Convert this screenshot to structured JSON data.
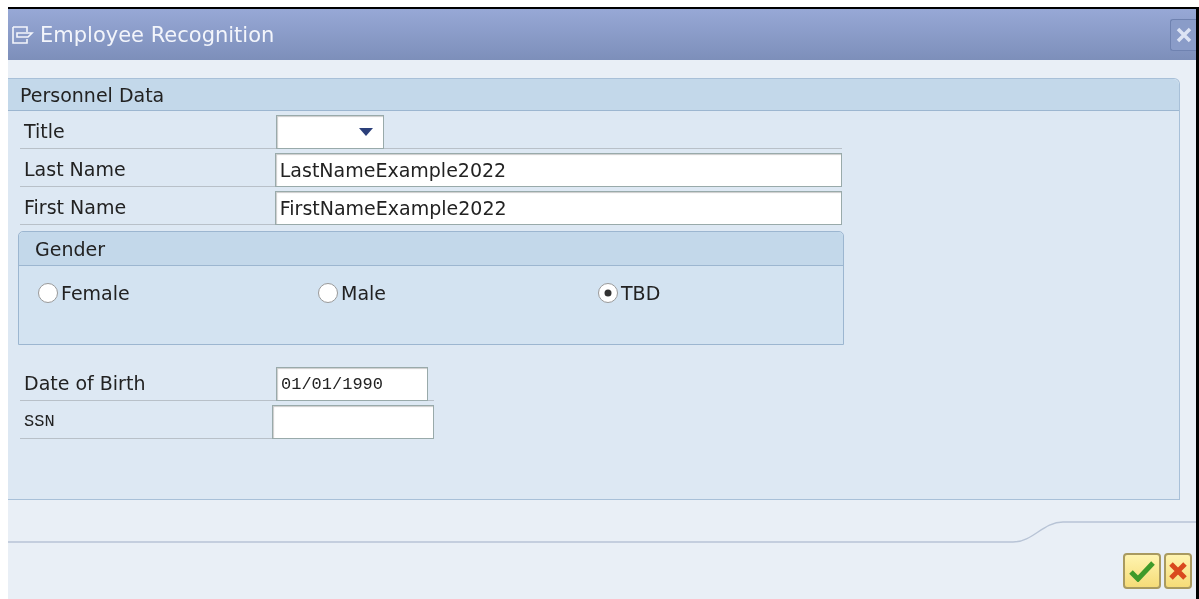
{
  "window": {
    "title": "Employee Recognition"
  },
  "section": {
    "title": "Personnel Data"
  },
  "fields": [
    {
      "kind": "dropdown",
      "label": "Title"
    },
    {
      "kind": "text",
      "label": "Last Name",
      "value": "LastNameExample2022"
    },
    {
      "kind": "text",
      "label": "First Name",
      "value": "FirstNameExample2022"
    }
  ],
  "gender": {
    "title": "Gender",
    "options": [
      {
        "label": "Female",
        "selected": false
      },
      {
        "label": "Male",
        "selected": false
      },
      {
        "label": "TBD",
        "selected": true
      }
    ]
  },
  "extra_fields": [
    {
      "kind": "date",
      "label": "Date of Birth",
      "value": "01/01/1990"
    },
    {
      "kind": "mono",
      "label": "SSN"
    }
  ]
}
